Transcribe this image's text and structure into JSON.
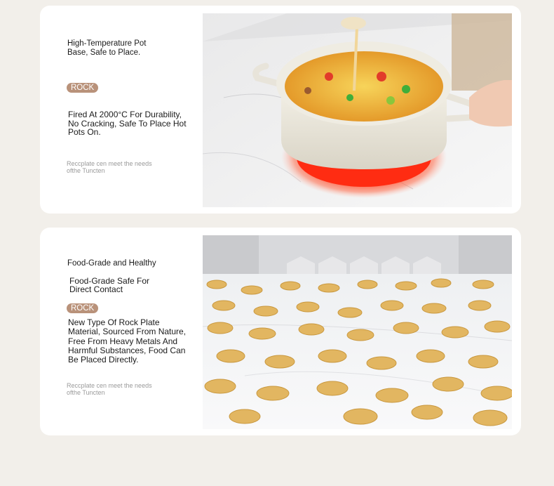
{
  "section_heat": {
    "title": "High-Temperature Pot Base, Safe to Place.",
    "badge": "ROCK",
    "description": "Fired At 2000°C For Durability, No Cracking, Safe To Place Hot Pots On.",
    "note_line1": "Reccplate cen meet the needs",
    "note_line2": "ofthe Tuncten"
  },
  "section_food": {
    "title": "Food-Grade and Healthy",
    "subtitle": "Food-Grade Safe For Direct Contact",
    "badge": "ROCK",
    "description": "New Type Of Rock Plate Material, Sourced From Nature, Free From Heavy Metals And Harmful Substances, Food Can Be Placed Directly.",
    "note_line1": "Reccplate cen meet the needs",
    "note_line2": "ofthe Tuncten"
  }
}
